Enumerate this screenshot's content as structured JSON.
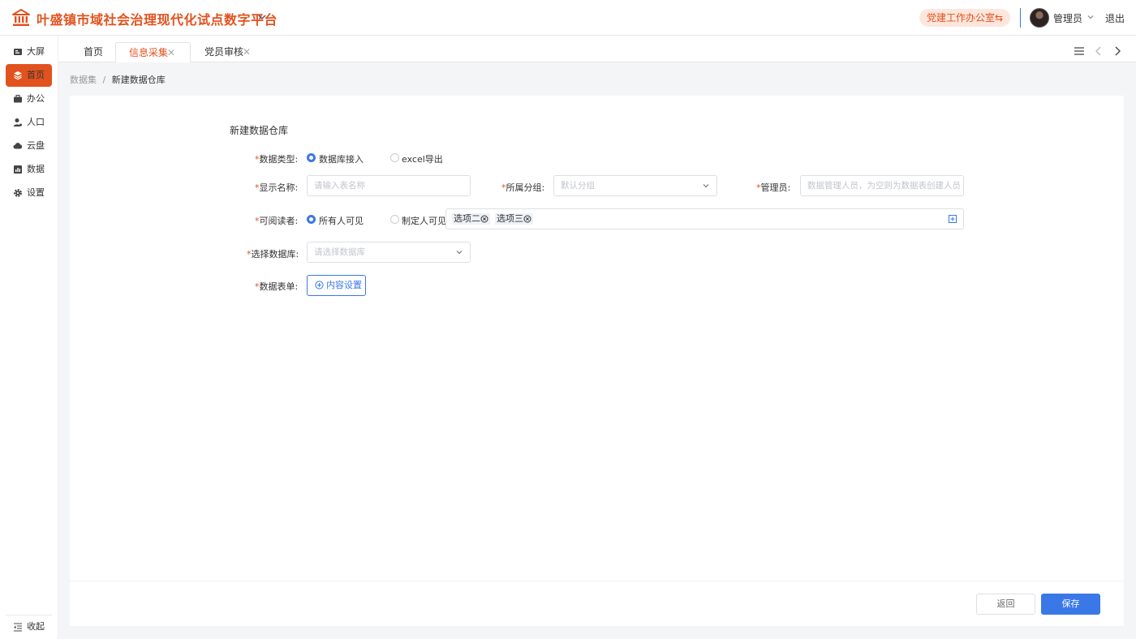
{
  "header": {
    "title": "叶盛镇市域社会治理现代化试点数字平台",
    "office": "党建工作办公室",
    "office_icon": "swap-icon",
    "user_name": "管理员",
    "logout": "退出",
    "brand_color": "#e2521e",
    "accent_color": "#3a78e8"
  },
  "sidebar": {
    "items": [
      {
        "label": "大屏",
        "icon": "screen-icon",
        "active": false
      },
      {
        "label": "首页",
        "icon": "layers-icon",
        "active": true
      },
      {
        "label": "办公",
        "icon": "briefcase-icon",
        "active": false
      },
      {
        "label": "人口",
        "icon": "person-icon",
        "active": false
      },
      {
        "label": "云盘",
        "icon": "cloud-icon",
        "active": false
      },
      {
        "label": "数据",
        "icon": "bar-chart-icon",
        "active": false
      },
      {
        "label": "设置",
        "icon": "gear-icon",
        "active": false
      }
    ],
    "collapse": "收起"
  },
  "tabs": [
    {
      "label": "首页",
      "active": false,
      "closable": false
    },
    {
      "label": "信息采集",
      "active": true,
      "closable": true
    },
    {
      "label": "党员审核",
      "active": false,
      "closable": true
    }
  ],
  "breadcrumb": {
    "parent": "数据集",
    "separator": "/",
    "current": "新建数据仓库"
  },
  "form": {
    "title": "新建数据仓库",
    "data_type": {
      "label": "数据类型:",
      "options": [
        {
          "label": "数据库接入",
          "selected": true
        },
        {
          "label": "excel导出",
          "selected": false
        }
      ]
    },
    "display_name": {
      "label": "显示名称:",
      "placeholder": "请输入表名称"
    },
    "group": {
      "label": "所属分组:",
      "placeholder": "默认分组"
    },
    "admin": {
      "label": "管理员:",
      "placeholder": "数据管理人员，为空则为数据表创建人员"
    },
    "readers": {
      "label": "可阅读者:",
      "options": [
        {
          "label": "所有人可见",
          "selected": true
        },
        {
          "label": "制定人可见",
          "selected": false
        }
      ],
      "tags": [
        "选项二",
        "选项三"
      ]
    },
    "database": {
      "label": "选择数据库:",
      "placeholder": "请选择数据库"
    },
    "data_form": {
      "label": "数据表单:",
      "button": "内容设置"
    }
  },
  "footer": {
    "back": "返回",
    "save": "保存"
  }
}
